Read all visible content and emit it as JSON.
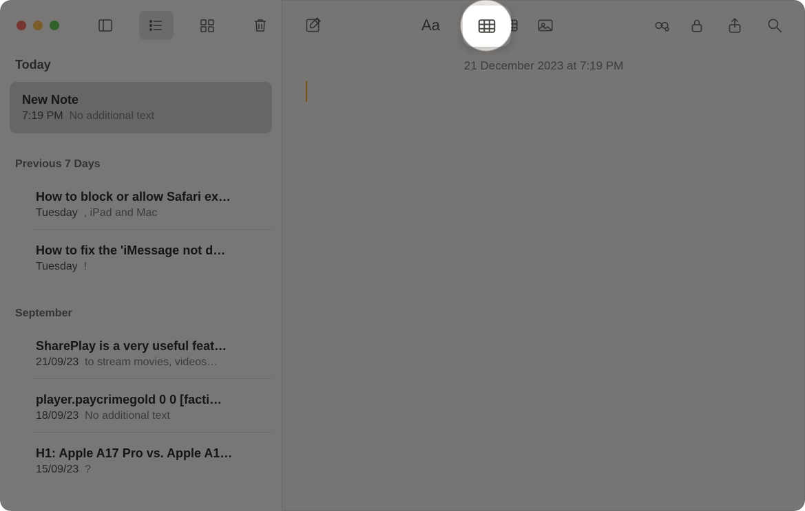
{
  "sidebar": {
    "sections": [
      {
        "header": "Today",
        "class": "section-header"
      },
      {
        "header": "Previous 7 Days",
        "class": "section-header small"
      },
      {
        "header": "September",
        "class": "section-header small"
      }
    ]
  },
  "notes": {
    "today": [
      {
        "title": "New Note",
        "time": "7:19 PM",
        "snippet": "No additional text"
      }
    ],
    "prev7": [
      {
        "title": "How to block or allow Safari ex…",
        "time": "Tuesday",
        "snippet": ", iPad and Mac"
      },
      {
        "title": "How to fix the 'iMessage not d…",
        "time": "Tuesday",
        "snippet": "!"
      }
    ],
    "september": [
      {
        "title": "SharePlay is a very useful feat…",
        "time": "21/09/23",
        "snippet": "to stream movies, videos…"
      },
      {
        "title": "player.paycrimegold 0 0 [facti…",
        "time": "18/09/23",
        "snippet": "No additional text"
      },
      {
        "title": "H1: Apple A17 Pro vs. Apple A1…",
        "time": "15/09/23",
        "snippet": "?"
      }
    ]
  },
  "editor": {
    "datestamp": "21 December 2023 at 7:19 PM"
  },
  "toolbar": {
    "format_label": "Aa"
  }
}
